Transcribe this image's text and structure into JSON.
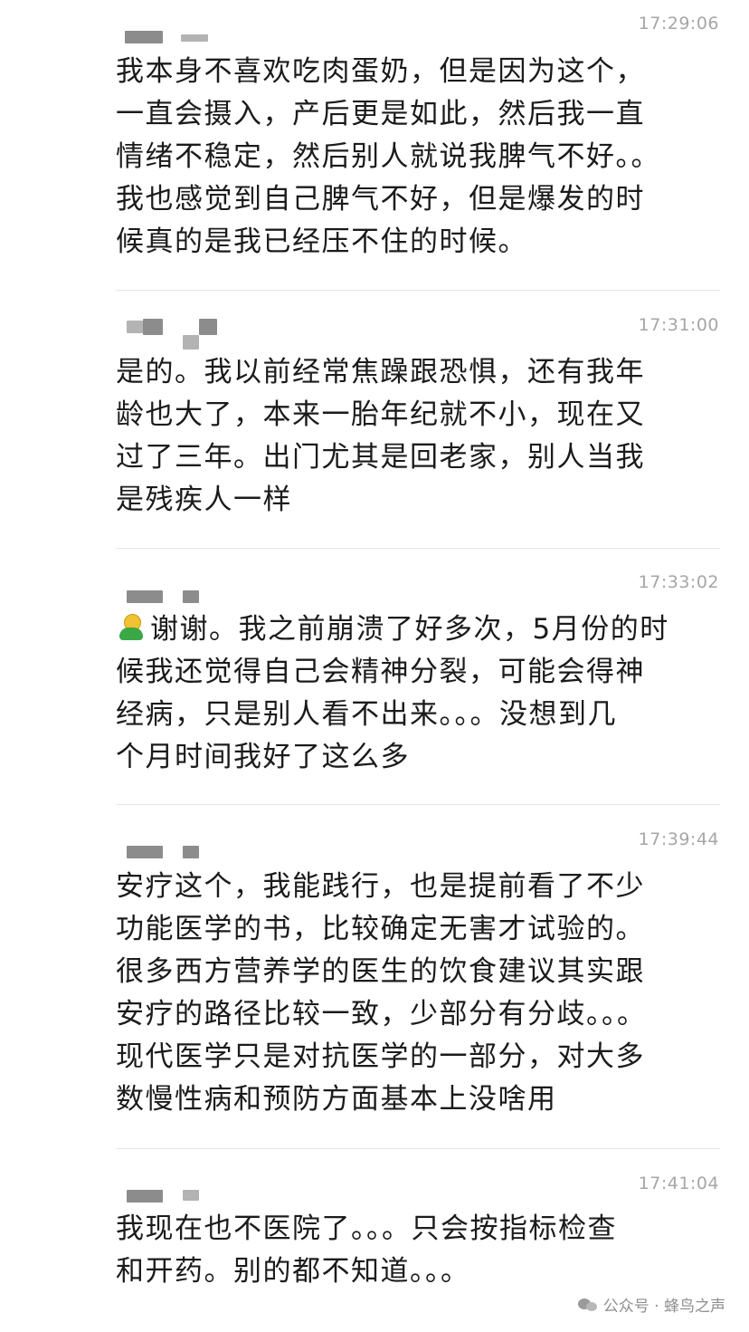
{
  "messages": [
    {
      "time": "17:29:06",
      "lines": [
        "我本身不喜欢吃肉蛋奶，但是因为这个，",
        "一直会摄入，产后更是如此，然后我一直",
        "情绪不稳定，然后别人就说我脾气不好。。",
        "我也感觉到自己脾气不好，但是爆发的时",
        "候真的是我已经压不住的时候。"
      ]
    },
    {
      "time": "17:31:00",
      "lines": [
        "是的。我以前经常焦躁跟恐惧，还有我年",
        "龄也大了，本来一胎年纪就不小，现在又",
        "过了三年。出门尤其是回老家，别人当我",
        "是残疾人一样"
      ]
    },
    {
      "time": "17:33:02",
      "lines": [
        "谢谢。我之前崩溃了好多次，5月份的时",
        "候我还觉得自己会精神分裂，可能会得神",
        "经病，只是别人看不出来。。。没想到几",
        "个月时间我好了这么多"
      ]
    },
    {
      "time": "17:39:44",
      "lines": [
        "安疗这个，我能践行，也是提前看了不少",
        "功能医学的书，比较确定无害才试验的。",
        "很多西方营养学的医生的饮食建议其实跟",
        "安疗的路径比较一致，少部分有分歧。。。",
        "现代医学只是对抗医学的一部分，对大多",
        "数慢性病和预防方面基本上没啥用"
      ]
    },
    {
      "time": "17:41:04",
      "lines": [
        "我现在也不医院了。。。只会按指标检查",
        "和开药。别的都不知道。。。"
      ]
    }
  ],
  "emoji_icon": "person-emoji-icon",
  "watermark": {
    "icon": "wechat-icon",
    "text": "公众号 · 蜂鸟之声"
  }
}
